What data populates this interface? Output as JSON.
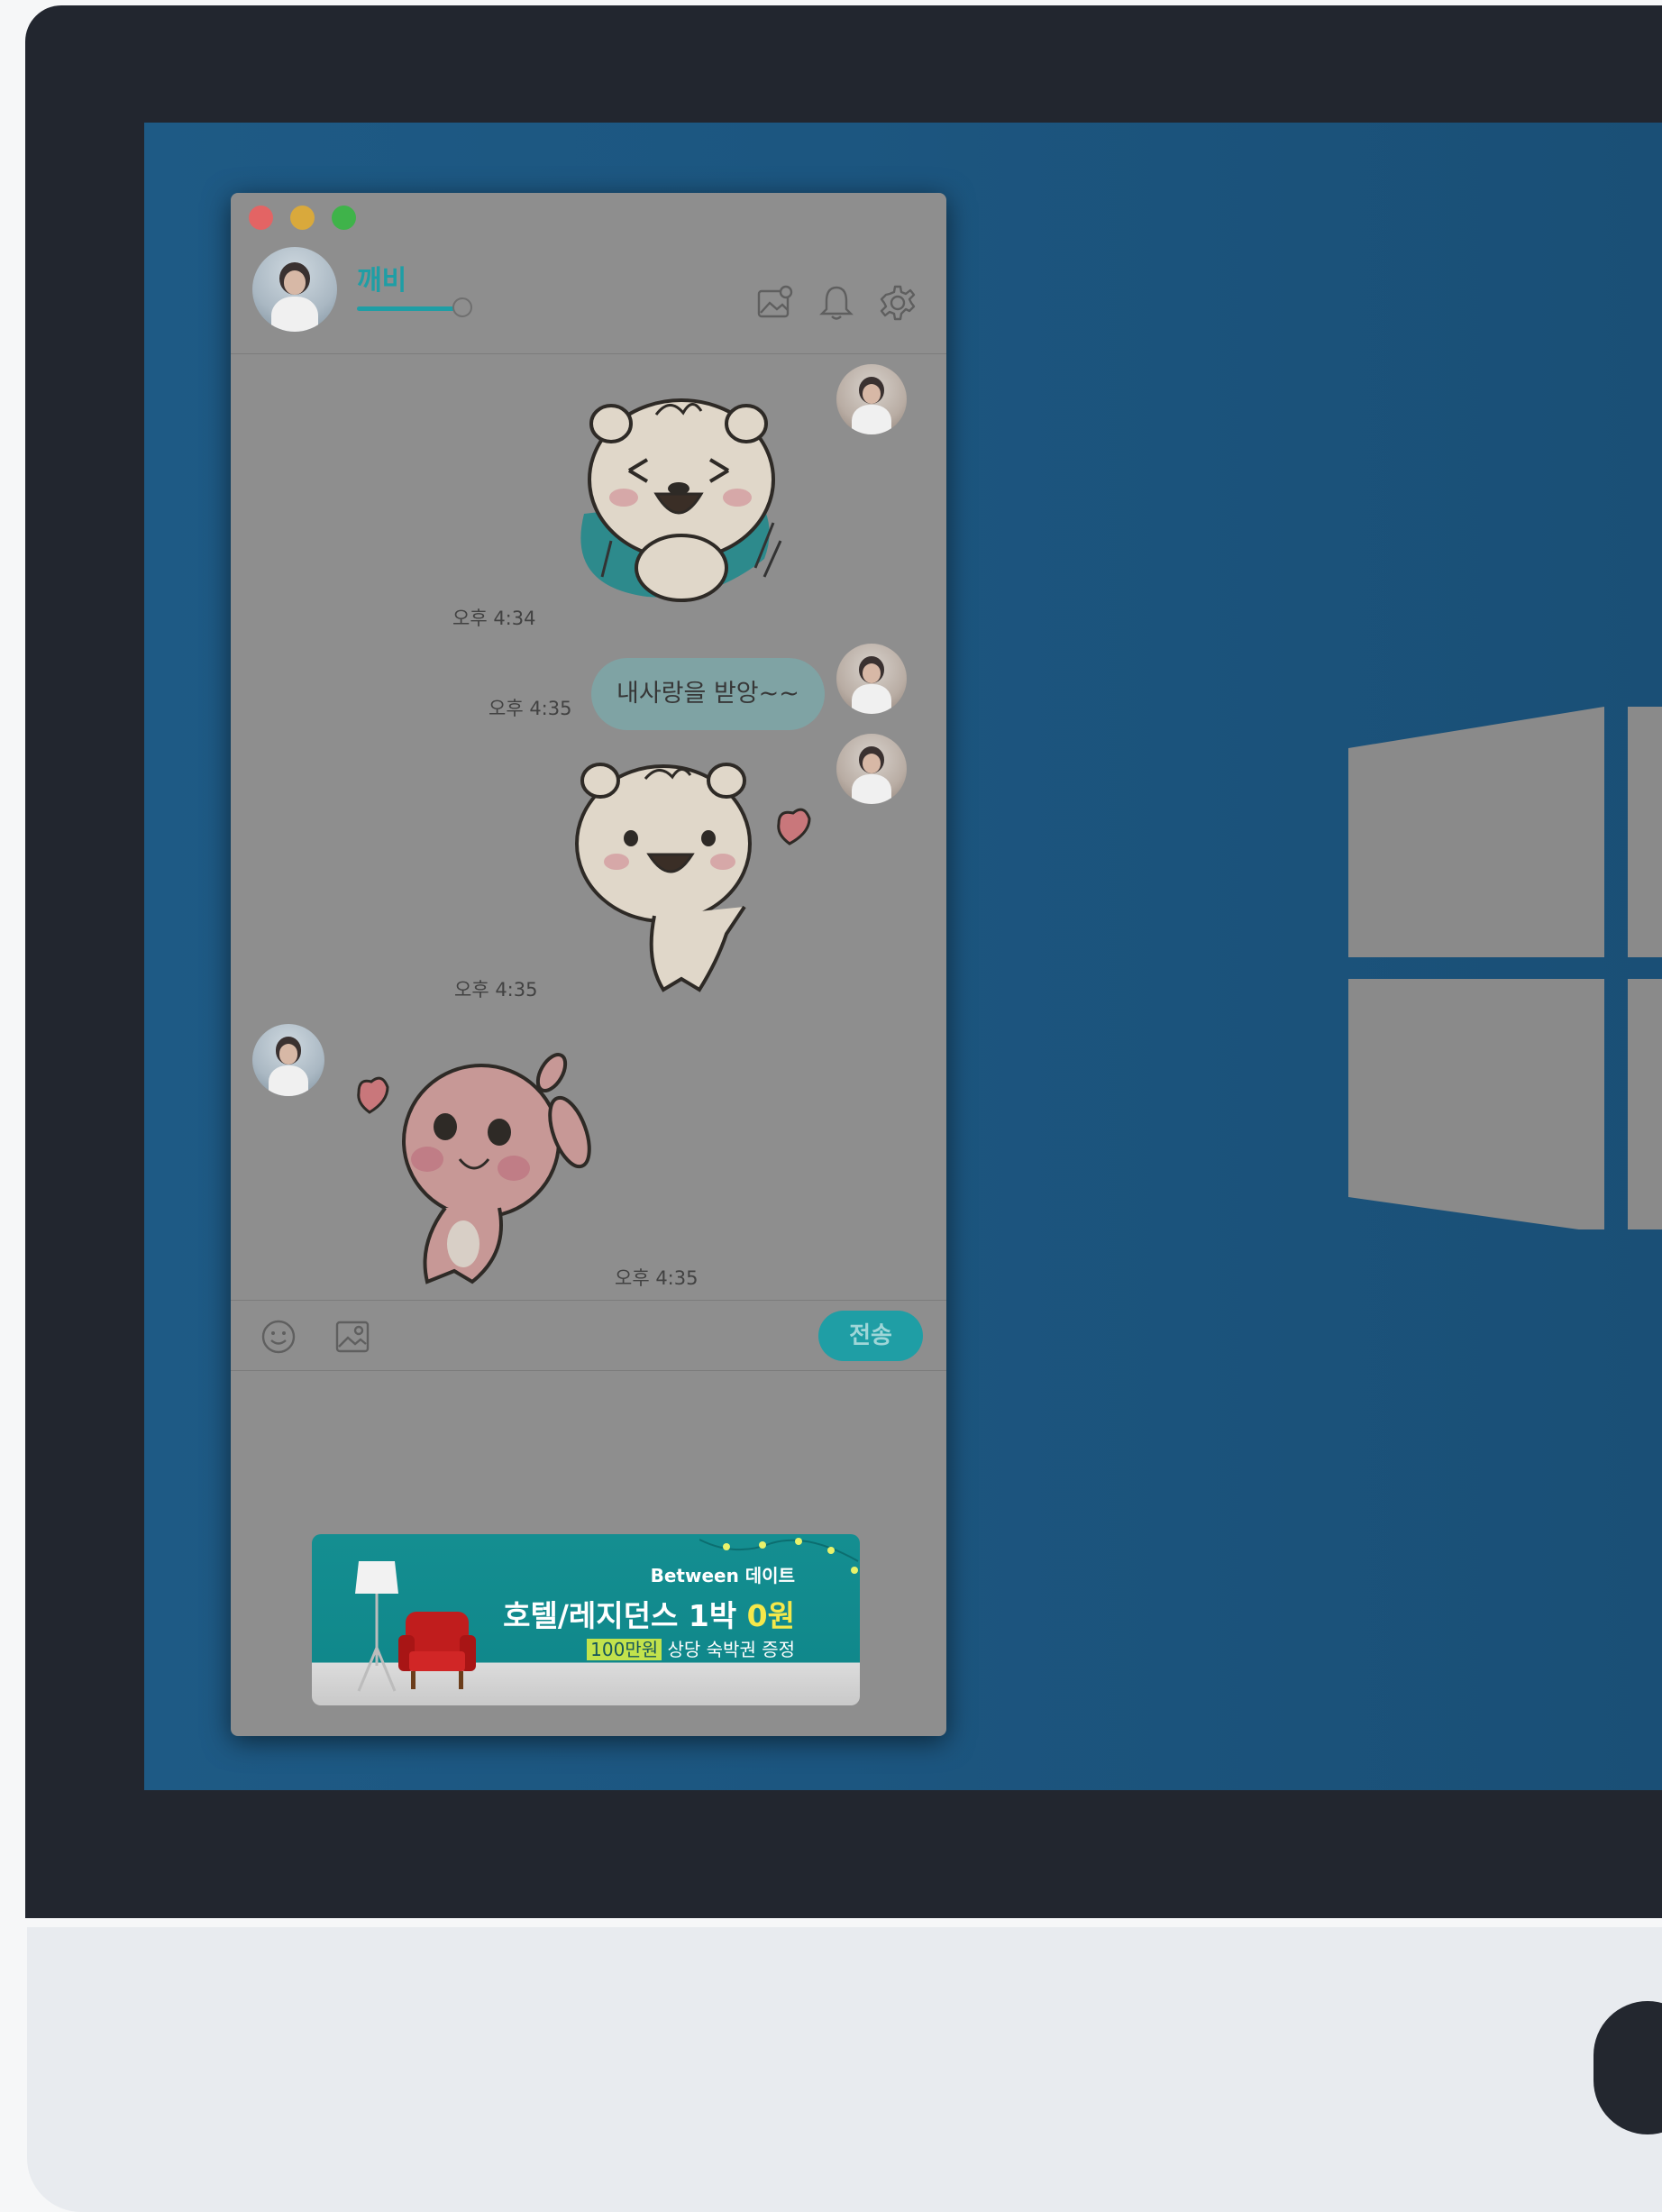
{
  "chat": {
    "contact_name": "깨비",
    "messages": [
      {
        "from": "her",
        "type": "sticker",
        "time": "오후 4:34"
      },
      {
        "from": "her",
        "type": "text",
        "text": "내사랑을 받앙~~",
        "time": "오후 4:35"
      },
      {
        "from": "her",
        "type": "sticker",
        "time": "오후 4:35"
      },
      {
        "from": "him",
        "type": "sticker",
        "time": "오후 4:35"
      }
    ]
  },
  "input": {
    "send_label": "전송"
  },
  "ad": {
    "brand": "Between 데이트",
    "title_prefix": "호텔/레지던스 1박 ",
    "title_highlight": "0원",
    "sub_highlight": "100만원",
    "sub_rest": " 상당 숙박권 증정"
  },
  "colors": {
    "accent": "#1f9ea5",
    "desktop": "#1c5680",
    "bezel": "#22262f",
    "overlay": "#8e8e8e"
  },
  "icons": [
    "gallery-icon",
    "bell-icon",
    "gear-icon",
    "emoji-icon",
    "image-icon",
    "windows-logo-icon"
  ]
}
